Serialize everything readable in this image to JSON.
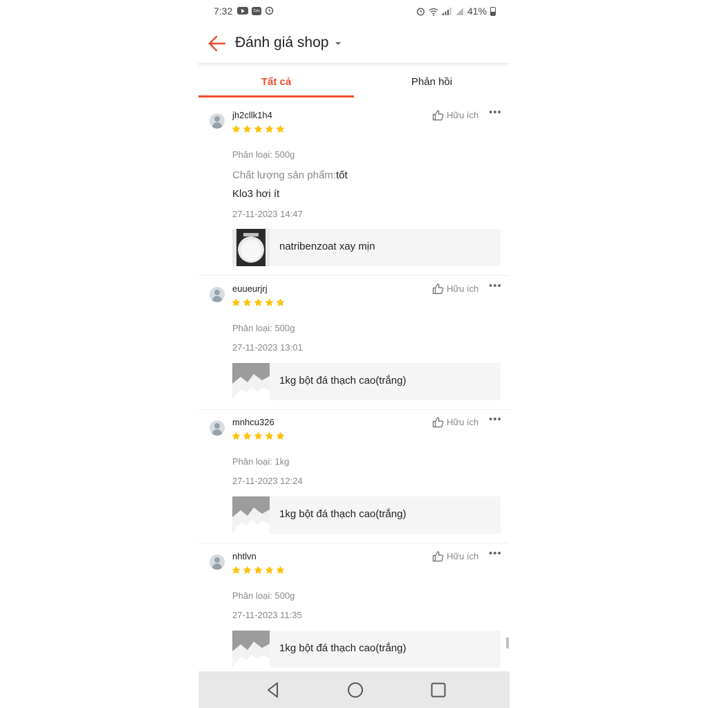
{
  "status_bar": {
    "time": "7:32",
    "zalo": "Zalo",
    "battery": "41%"
  },
  "header": {
    "title": "Đánh giá shop"
  },
  "tabs": [
    {
      "label": "Tất cả",
      "active": true
    },
    {
      "label": "Phản hồi",
      "active": false
    }
  ],
  "colors": {
    "accent": "#ee4d2d",
    "star": "#ffc107"
  },
  "reviews": [
    {
      "username": "jh2cllk1h4",
      "rating": 5,
      "helpful_label": "Hữu ích",
      "variant": "Phân loại: 500g",
      "quality_label": "Chất lượng sản phẩm:",
      "quality_value": "tốt",
      "comment": "Klo3 hơi ít",
      "datetime": "27-11-2023 14:47",
      "product_name": "natribenzoat xay mịn"
    },
    {
      "username": "euueurjrj",
      "rating": 5,
      "helpful_label": "Hữu ích",
      "variant": "Phân loại: 500g",
      "datetime": "27-11-2023 13:01",
      "product_name": "1kg bột đá thạch cao(trắng)"
    },
    {
      "username": "mnhcu326",
      "rating": 5,
      "helpful_label": "Hữu ích",
      "variant": "Phân loại: 1kg",
      "datetime": "27-11-2023 12:24",
      "product_name": "1kg bột đá thạch cao(trắng)"
    },
    {
      "username": "nhtlvn",
      "rating": 5,
      "helpful_label": "Hữu ích",
      "variant": "Phân loại: 500g",
      "datetime": "27-11-2023 11:35",
      "product_name": "1kg bột đá thạch cao(trắng)"
    }
  ],
  "nav": {
    "icons": [
      "back-triangle-icon",
      "home-circle-icon",
      "recents-square-icon"
    ]
  }
}
